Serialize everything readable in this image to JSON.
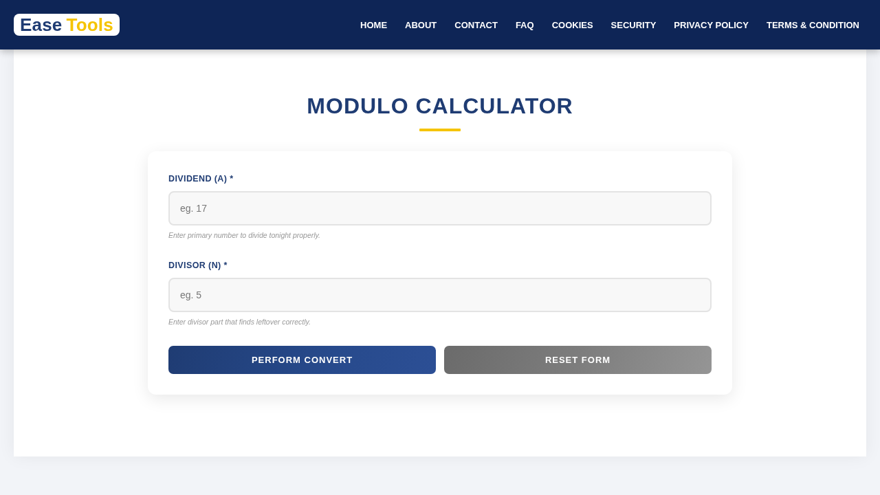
{
  "header": {
    "logo": {
      "words": [
        {
          "text": "Ease",
          "color": "#1f3c73"
        },
        {
          "text": "Tools",
          "color": "#f5c400"
        }
      ]
    },
    "nav": [
      {
        "label": "HOME"
      },
      {
        "label": "ABOUT"
      },
      {
        "label": "CONTACT"
      },
      {
        "label": "FAQ"
      },
      {
        "label": "COOKIES"
      },
      {
        "label": "SECURITY"
      },
      {
        "label": "PRIVACY POLICY"
      },
      {
        "label": "TERMS & CONDITION"
      }
    ]
  },
  "page": {
    "title": "MODULO CALCULATOR"
  },
  "form": {
    "fields": [
      {
        "label": "DIVIDEND (A) *",
        "placeholder": "eg. 17",
        "hint": "Enter primary number to divide tonight properly."
      },
      {
        "label": "DIVISOR (N) *",
        "placeholder": "eg. 5",
        "hint": "Enter divisor part that finds leftover correctly."
      }
    ],
    "buttons": [
      {
        "kind": "primary",
        "label": "PERFORM CONVERT"
      },
      {
        "kind": "secondary",
        "label": "RESET FORM"
      }
    ]
  }
}
